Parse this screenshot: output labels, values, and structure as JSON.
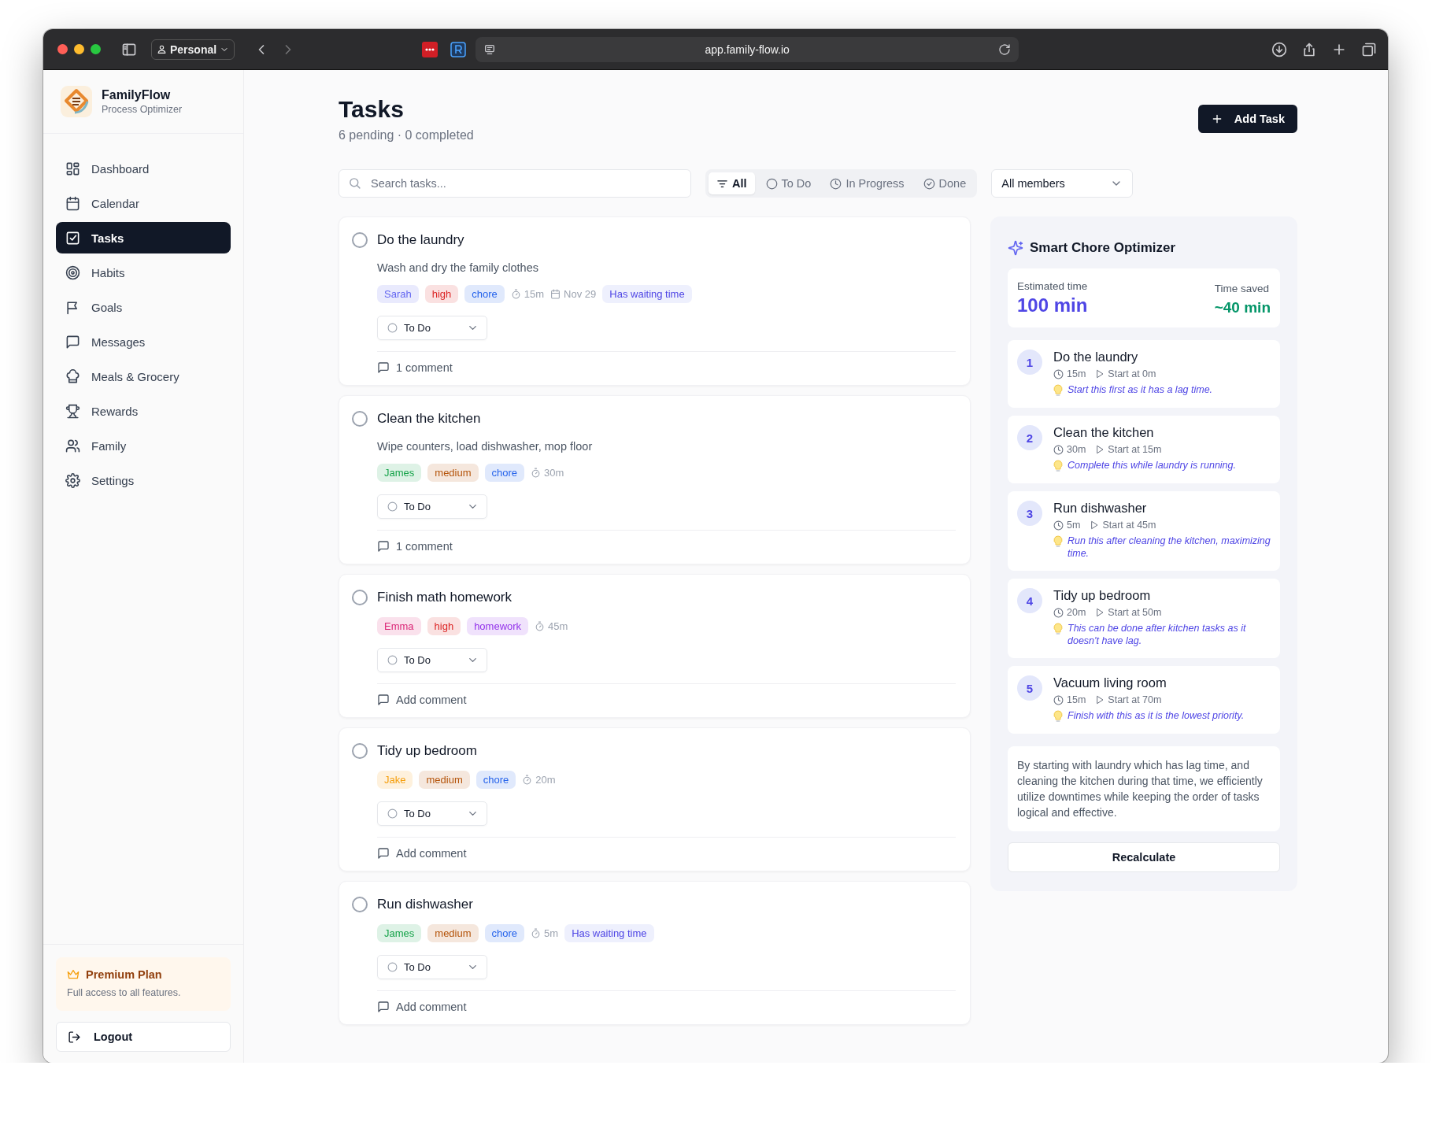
{
  "browser": {
    "profile": "Personal",
    "url": "app.family-flow.io"
  },
  "sidebar": {
    "app_name": "FamilyFlow",
    "app_subtitle": "Process Optimizer",
    "items": [
      {
        "label": "Dashboard",
        "selected": false
      },
      {
        "label": "Calendar",
        "selected": false
      },
      {
        "label": "Tasks",
        "selected": true
      },
      {
        "label": "Habits",
        "selected": false
      },
      {
        "label": "Goals",
        "selected": false
      },
      {
        "label": "Messages",
        "selected": false
      },
      {
        "label": "Meals & Grocery",
        "selected": false
      },
      {
        "label": "Rewards",
        "selected": false
      },
      {
        "label": "Family",
        "selected": false
      },
      {
        "label": "Settings",
        "selected": false
      }
    ],
    "plan": {
      "title": "Premium Plan",
      "description": "Full access to all features."
    },
    "logout": "Logout"
  },
  "header": {
    "title": "Tasks",
    "subtitle": "6 pending · 0 completed",
    "add_button": "Add Task"
  },
  "toolbar": {
    "search": {
      "placeholder": "Search tasks..."
    },
    "filters": [
      {
        "label": "All",
        "selected": true
      },
      {
        "label": "To Do",
        "selected": false
      },
      {
        "label": "In Progress",
        "selected": false
      },
      {
        "label": "Done",
        "selected": false
      }
    ],
    "member_select": "All members"
  },
  "tasks": [
    {
      "title": "Do the laundry",
      "completed": false,
      "description": "Wash and dry the family clothes",
      "tags": [
        {
          "kind": "member",
          "label": "Sarah",
          "color": "#6366f1"
        },
        {
          "kind": "priority",
          "label": "high",
          "color": "#dc2626"
        },
        {
          "kind": "category",
          "label": "chore",
          "color": "#2563eb"
        },
        {
          "kind": "duration",
          "label": "15m"
        },
        {
          "kind": "date",
          "label": "Nov 29"
        },
        {
          "kind": "waiting",
          "label": "Has waiting time"
        }
      ],
      "status": "To Do",
      "comment": "1 comment"
    },
    {
      "title": "Clean the kitchen",
      "completed": false,
      "description": "Wipe counters, load dishwasher, mop floor",
      "tags": [
        {
          "kind": "member",
          "label": "James",
          "color": "#16a34a"
        },
        {
          "kind": "priority",
          "label": "medium",
          "color": "#b45309"
        },
        {
          "kind": "category",
          "label": "chore",
          "color": "#2563eb"
        },
        {
          "kind": "duration",
          "label": "30m"
        }
      ],
      "status": "To Do",
      "comment": "1 comment"
    },
    {
      "title": "Finish math homework",
      "completed": false,
      "tags": [
        {
          "kind": "member",
          "label": "Emma",
          "color": "#db2777"
        },
        {
          "kind": "priority",
          "label": "high",
          "color": "#dc2626"
        },
        {
          "kind": "category",
          "label": "homework",
          "color": "#9333ea"
        },
        {
          "kind": "duration",
          "label": "45m"
        }
      ],
      "status": "To Do",
      "comment": "Add comment"
    },
    {
      "title": "Tidy up bedroom",
      "completed": false,
      "tags": [
        {
          "kind": "member",
          "label": "Jake",
          "color": "#f59e0b"
        },
        {
          "kind": "priority",
          "label": "medium",
          "color": "#b45309"
        },
        {
          "kind": "category",
          "label": "chore",
          "color": "#2563eb"
        },
        {
          "kind": "duration",
          "label": "20m"
        }
      ],
      "status": "To Do",
      "comment": "Add comment"
    },
    {
      "title": "Run dishwasher",
      "completed": false,
      "tags": [
        {
          "kind": "member",
          "label": "James",
          "color": "#16a34a"
        },
        {
          "kind": "priority",
          "label": "medium",
          "color": "#b45309"
        },
        {
          "kind": "category",
          "label": "chore",
          "color": "#2563eb"
        },
        {
          "kind": "duration",
          "label": "5m"
        },
        {
          "kind": "waiting",
          "label": "Has waiting time"
        }
      ],
      "status": "To Do",
      "comment": "Add comment"
    }
  ],
  "optimizer": {
    "title": "Smart Chore Optimizer",
    "estimated_label": "Estimated time",
    "estimated_value": "100 min",
    "saved_label": "Time saved",
    "saved_value": "~40 min",
    "steps": [
      {
        "number": "1",
        "title": "Do the laundry",
        "duration": "15m",
        "start": "Start at 0m",
        "tip": "Start this first as it has a lag time."
      },
      {
        "number": "2",
        "title": "Clean the kitchen",
        "duration": "30m",
        "start": "Start at 15m",
        "tip": "Complete this while laundry is running."
      },
      {
        "number": "3",
        "title": "Run dishwasher",
        "duration": "5m",
        "start": "Start at 45m",
        "tip": "Run this after cleaning the kitchen, maximizing time."
      },
      {
        "number": "4",
        "title": "Tidy up bedroom",
        "duration": "20m",
        "start": "Start at 50m",
        "tip": "This can be done after kitchen tasks as it doesn't have lag."
      },
      {
        "number": "5",
        "title": "Vacuum living room",
        "duration": "15m",
        "start": "Start at 70m",
        "tip": "Finish with this as it is the lowest priority."
      }
    ],
    "summary": "By starting with laundry which has lag time, and cleaning the kitchen during that time, we efficiently utilize downtimes while keeping the order of tasks logical and effective.",
    "button": "Recalculate"
  }
}
